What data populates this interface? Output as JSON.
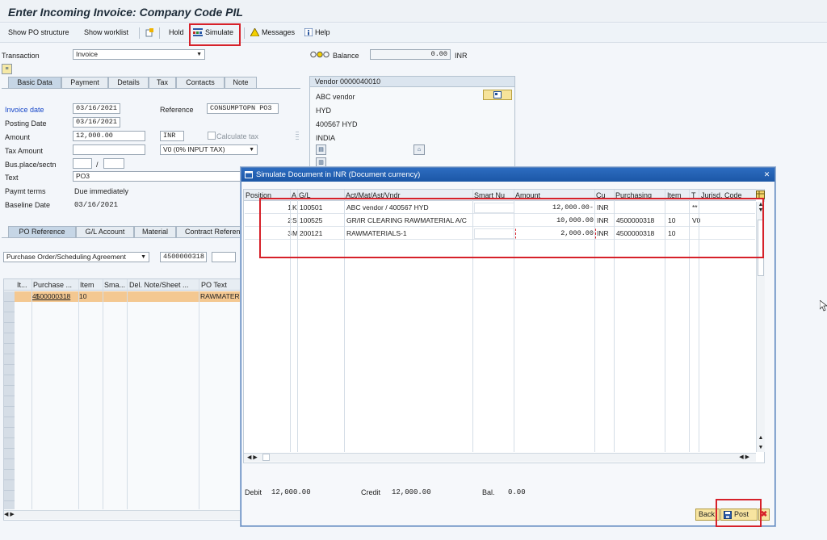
{
  "window_title": "Enter Incoming Invoice: Company Code PIL",
  "toolbar": {
    "show_po_structure": "Show PO structure",
    "show_worklist": "Show worklist",
    "hold": "Hold",
    "simulate": "Simulate",
    "messages": "Messages",
    "help": "Help"
  },
  "header": {
    "transaction_label": "Transaction",
    "transaction_value": "Invoice",
    "balance_label": "Balance",
    "balance_value": "0.00",
    "balance_currency": "INR"
  },
  "tabs": [
    "Basic Data",
    "Payment",
    "Details",
    "Tax",
    "Contacts",
    "Note"
  ],
  "basic_data": {
    "invoice_date_label": "Invoice date",
    "invoice_date": "03/16/2021",
    "reference_label": "Reference",
    "reference": "CONSUMPTOPN PO3",
    "posting_date_label": "Posting Date",
    "posting_date": "03/16/2021",
    "amount_label": "Amount",
    "amount": "12,000.00",
    "currency": "INR",
    "calculate_tax": "Calculate tax",
    "tax_amount_label": "Tax Amount",
    "tax_code": "V0 (0% INPUT TAX)",
    "bus_place_label": "Bus.place/sectn",
    "bus_sep": "/",
    "text_label": "Text",
    "text_value": "PO3",
    "paymt_terms_label": "Paymt terms",
    "paymt_terms_value": "Due immediately",
    "baseline_date_label": "Baseline Date",
    "baseline_date": "03/16/2021"
  },
  "vendor": {
    "title": "Vendor 0000040010",
    "name": "ABC vendor",
    "city": "HYD",
    "postal": "400567 HYD",
    "country": "INDIA"
  },
  "po_tabs": [
    "PO Reference",
    "G/L Account",
    "Material",
    "Contract Referen"
  ],
  "po_ref": {
    "doc_type": "Purchase Order/Scheduling Agreement",
    "po_number": "4500000318"
  },
  "po_grid": {
    "headers": [
      "It...",
      "Purchase ...",
      "Item",
      "Sma...",
      "Del. Note/Sheet ...",
      "PO Text"
    ],
    "rows": [
      {
        "item": "1",
        "po": "4500000318",
        "po_item": "10",
        "text": "RAWMATER"
      }
    ]
  },
  "dialog": {
    "title": "Simulate Document in INR (Document currency)",
    "headers": [
      "Position",
      "A",
      "G/L",
      "Act/Mat/Ast/Vndr",
      "Smart Nu",
      "Amount",
      "Cu",
      "Purchasing",
      "Item",
      "T",
      "Jurisd. Code"
    ],
    "rows": [
      {
        "pos": "1",
        "a": "K",
        "gl": "100501",
        "desc": "ABC vendor / 400567 HYD",
        "amount": "12,000.00-",
        "cu": "INR",
        "po": "",
        "item": "",
        "t": "**"
      },
      {
        "pos": "2",
        "a": "S",
        "gl": "100525",
        "desc": "GR/IR CLEARING RAWMATERIAL A/C",
        "amount": "10,000.00",
        "cu": "INR",
        "po": "4500000318",
        "item": "10",
        "t": "V0"
      },
      {
        "pos": "3",
        "a": "M",
        "gl": "200121",
        "desc": "RAWMATERIALS-1",
        "amount": "2,000.00",
        "cu": "INR",
        "po": "4500000318",
        "item": "10",
        "t": ""
      }
    ],
    "debit_label": "Debit",
    "debit": "12,000.00",
    "credit_label": "Credit",
    "credit": "12,000.00",
    "bal_label": "Bal.",
    "bal": "0.00",
    "back": "Back",
    "post": "Post"
  }
}
